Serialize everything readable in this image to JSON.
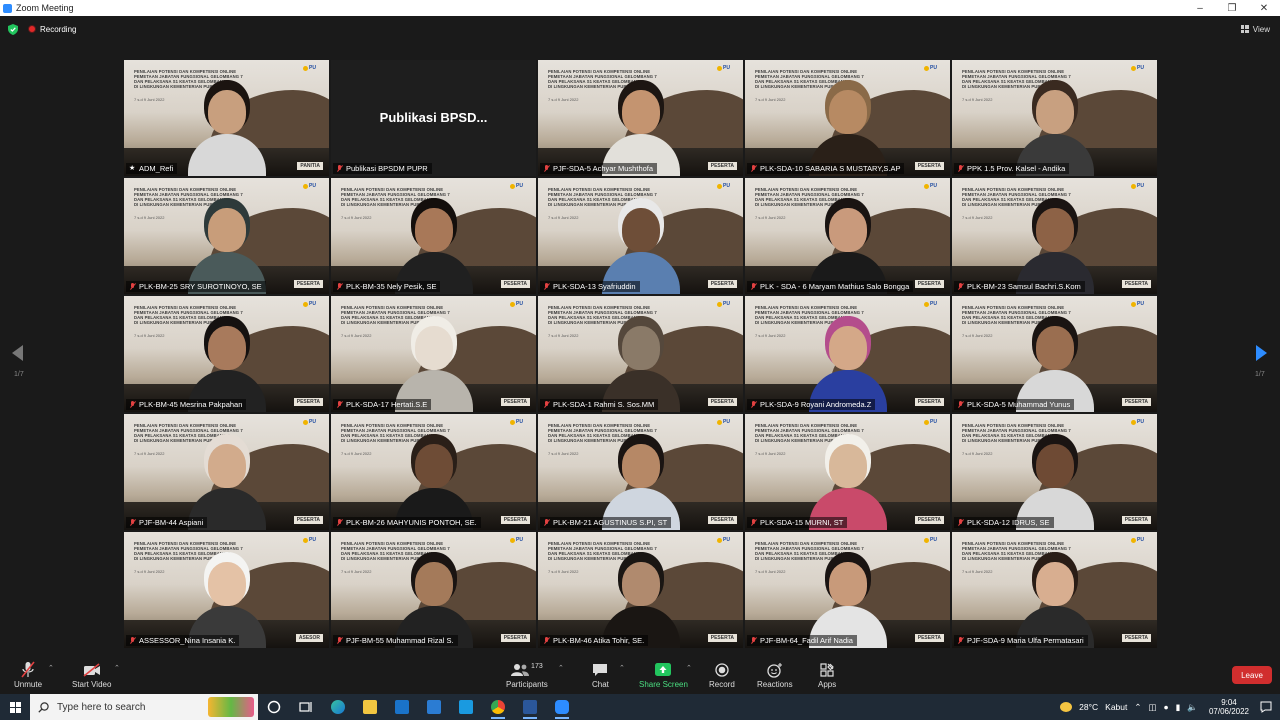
{
  "window": {
    "title": "Zoom Meeting"
  },
  "status": {
    "recording_label": "Recording",
    "view_label": "View"
  },
  "gallery": {
    "slide_title_lines": [
      "PENILAIAN POTENSI DAN KOMPETENSI ONLINE",
      "PEMETAAN JABATAN FUNGSIONAL GELOMBANG 7",
      "DAN PELAKSANA S1 KEATAS GELOMBANG 6",
      "DI LINGKUNGAN KEMENTERIAN PUPR"
    ],
    "slide_date": "7 s.d 9 Juni 2022",
    "logo_text": "PU",
    "role_peserta": "PESERTA",
    "role_panitia": "PANITIA",
    "role_asesor": "ASESOR",
    "center_text": "Publikasi  BPSD...",
    "tiles": [
      {
        "name": "ADM_Refi",
        "role": "PANITIA",
        "host": true,
        "active": true,
        "skin": "#c89f7e",
        "hair": "#1b1410",
        "shirt": "#d8d8d8"
      },
      {
        "name": "Publikasi BPSDM PUPR",
        "plain": true
      },
      {
        "name": "PJF-SDA-5 Achyar Mushthofa",
        "role": "PESERTA",
        "skin": "#c49470",
        "hair": "#1d1612",
        "shirt": "#e2e0da"
      },
      {
        "name": "PLK-SDA-10 SABARIA S MUSTARY,S.AP",
        "role": "PESERTA",
        "skin": "#b78a63",
        "hair": "#8a6a48",
        "shirt": "#2a2018"
      },
      {
        "name": "PPK 1.5 Prov. Kalsel - Andika",
        "role": "",
        "skin": "#c8a080",
        "hair": "#3a2a20",
        "shirt": "#3a3a3a"
      },
      {
        "name": "PLK-BM-25 SRY SUROTINOYO, SE",
        "role": "PESERTA",
        "skin": "#c89d7a",
        "hair": "#2e3a3a",
        "shirt": "#4a5a5a"
      },
      {
        "name": "PLK-BM-35 Nely Pesik, SE",
        "role": "PESERTA",
        "skin": "#a87858",
        "hair": "#140f0c",
        "shirt": "#202020"
      },
      {
        "name": "PLK-SDA-13 Syafriuddin",
        "role": "PESERTA",
        "skin": "#6e4e38",
        "hair": "#e8e8e8",
        "shirt": "#5a7fb0"
      },
      {
        "name": "PLK - SDA - 6 Maryam Mathius Salo Bongga",
        "role": "PESERTA",
        "skin": "#c99a7c",
        "hair": "#1a1412",
        "shirt": "#1a1a1a"
      },
      {
        "name": "PLK-BM-23 Samsul Bachri.S.Kom",
        "role": "PESERTA",
        "skin": "#8d6246",
        "hair": "#1a1412",
        "shirt": "#2a2a30"
      },
      {
        "name": "PLK-BM-45 Mesrina Pakpahan",
        "role": "PESERTA",
        "skin": "#a87a5c",
        "hair": "#151110",
        "shirt": "#222"
      },
      {
        "name": "PLK-SDA-17 Hertati.S.E",
        "role": "PESERTA",
        "skin": "#e6dcd0",
        "hair": "#f0ede6",
        "shirt": "#b8b4ac"
      },
      {
        "name": "PLK-SDA-1 Rahmi S. Sos.MM",
        "role": "PESERTA",
        "skin": "#8a7a68",
        "hair": "#55483c",
        "shirt": "#3a3028"
      },
      {
        "name": "PLK-SDA-9 Royani Andromeda.Z",
        "role": "PESERTA",
        "skin": "#d4a888",
        "hair": "#b44d8c",
        "shirt": "#2a3fa0"
      },
      {
        "name": "PLK-SDA-5 Muhammad Yunus",
        "role": "PESERTA",
        "skin": "#9a6e50",
        "hair": "#1a1412",
        "shirt": "#d8d8d8"
      },
      {
        "name": "PJF-BM-44 Aspiani",
        "role": "PESERTA",
        "skin": "#d2ab8c",
        "hair": "#e4dcd4",
        "shirt": "#2a2a2a"
      },
      {
        "name": "PLK-BM-26 MAHYUNIS PONTOH, SE.",
        "role": "PESERTA",
        "skin": "#6e4c36",
        "hair": "#2a1f18",
        "shirt": "#1a1a1a"
      },
      {
        "name": "PLK-BM-21 AGUSTINUS S.PI, ST",
        "role": "PESERTA",
        "skin": "#b68866",
        "hair": "#1a1412",
        "shirt": "#cfd6df"
      },
      {
        "name": "PLK-SDA-15 MURNI, ST",
        "role": "PESERTA",
        "skin": "#d8b89a",
        "hair": "#f2f0ea",
        "shirt": "#c94a6a"
      },
      {
        "name": "PLK-SDA-12 IDRUS, SE",
        "role": "PESERTA",
        "skin": "#6e4a34",
        "hair": "#1a1412",
        "shirt": "#d8d8d8"
      },
      {
        "name": "ASSESSOR_Nina Insania K.",
        "role": "ASESOR",
        "skin": "#e4c2a6",
        "hair": "#f4f4f2",
        "shirt": "#3a3a3a"
      },
      {
        "name": "PJF-BM-55 Muhammad Rizal S.",
        "role": "PESERTA",
        "skin": "#a47a5a",
        "hair": "#1a1412",
        "shirt": "#222"
      },
      {
        "name": "PLK-BM-46 Atika Tohir, SE.",
        "role": "PESERTA",
        "skin": "#b08a6e",
        "hair": "#1a1613",
        "shirt": "#1a1613"
      },
      {
        "name": "PJF-BM-64_Fadil Arif Nadia",
        "role": "PESERTA",
        "skin": "#c89a7a",
        "hair": "#1a1412",
        "shirt": "#e4e4e4"
      },
      {
        "name": "PJF-SDA-9 Maria Ulfa Permatasari",
        "role": "PESERTA",
        "skin": "#d8ae90",
        "hair": "#2a1d16",
        "shirt": "#2a2a2a"
      }
    ]
  },
  "pagination": {
    "left": "1/7",
    "right": "1/7"
  },
  "toolbar": {
    "unmute": "Unmute",
    "start_video": "Start Video",
    "participants": "Participants",
    "participants_count": "173",
    "chat": "Chat",
    "share_screen": "Share Screen",
    "record": "Record",
    "reactions": "Reactions",
    "apps": "Apps",
    "leave": "Leave"
  },
  "taskbar": {
    "search_placeholder": "Type here to search",
    "weather_temp": "28°C",
    "weather_desc": "Kabut",
    "time": "9:04",
    "date": "07/06/2022"
  },
  "colors": {
    "accent": "#2D8CFF",
    "leave": "#D12E2E",
    "share": "#22C55E",
    "active_border": "#D9E53A"
  }
}
